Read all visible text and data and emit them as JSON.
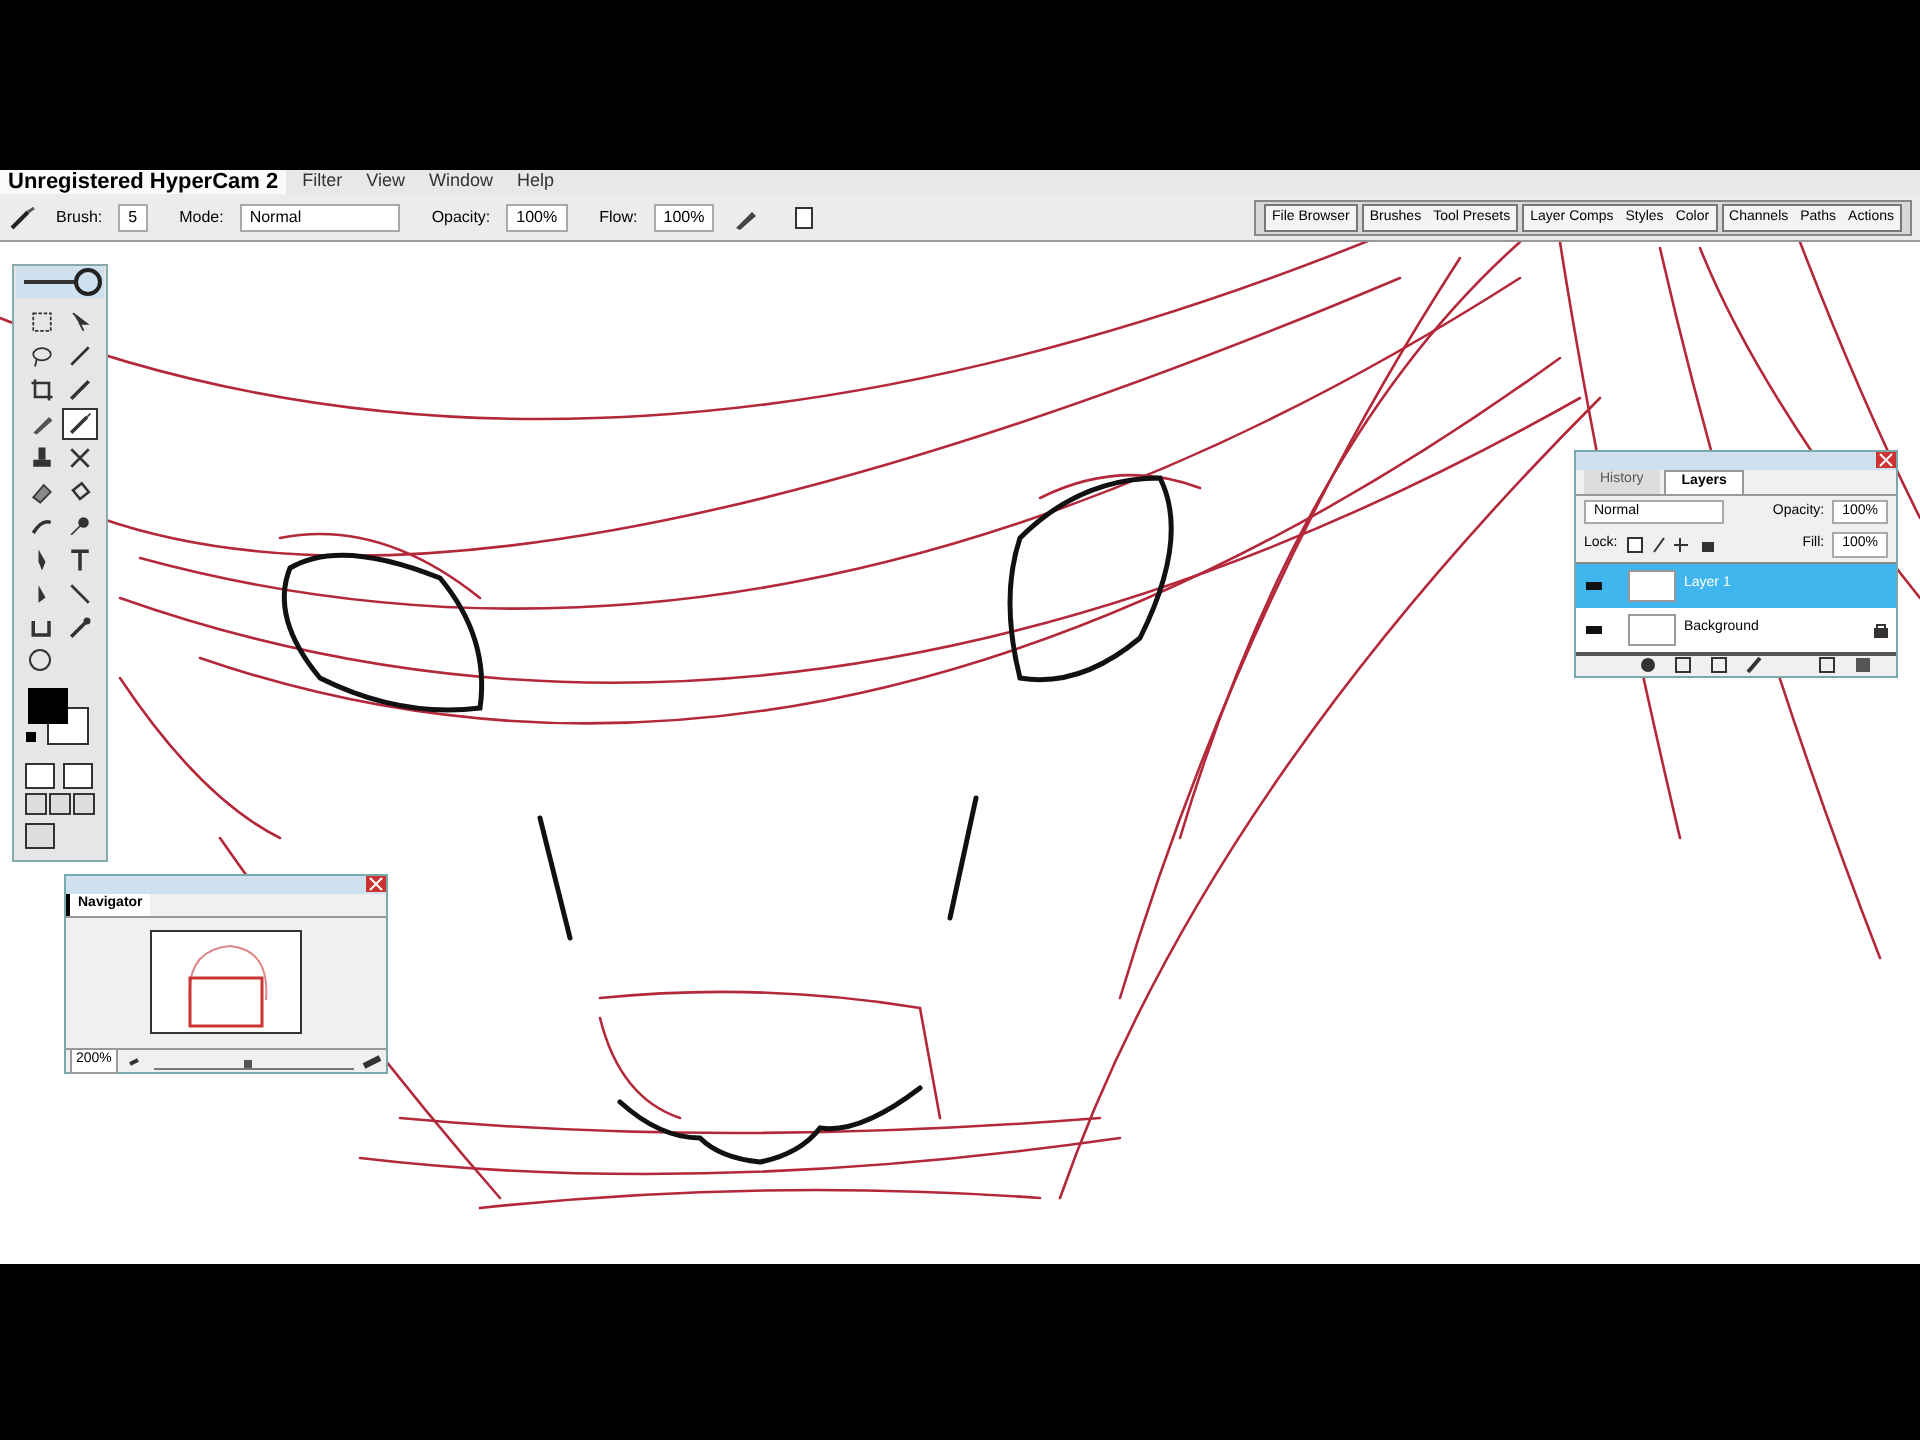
{
  "menu_bar": {
    "items": [
      "Filter",
      "View",
      "Window",
      "Help"
    ]
  },
  "recorder_caption": "Unregistered HyperCam 2",
  "options_bar": {
    "brush_label": "Brush:",
    "brush_size": "5",
    "mode_label": "Mode:",
    "mode": "Normal",
    "opacity_label": "Opacity:",
    "opacity": "100%",
    "flow_label": "Flow:",
    "flow": "100%"
  },
  "palette_well": {
    "groups": [
      [
        "File Browser"
      ],
      [
        "Brushes",
        "Tool Presets"
      ],
      [
        "Layer Comps",
        "Styles",
        "Color"
      ],
      [
        "Channels",
        "Paths",
        "Actions"
      ]
    ]
  },
  "toolbox": {
    "tools": [
      {
        "selected": false
      },
      {
        "selected": false
      },
      {
        "selected": false
      },
      {
        "selected": false
      },
      {
        "selected": false
      },
      {
        "selected": false
      },
      {
        "selected": false
      },
      {
        "selected": true
      },
      {
        "selected": false
      },
      {
        "selected": false
      },
      {
        "selected": false
      },
      {
        "selected": false
      },
      {
        "selected": false
      },
      {
        "selected": false
      },
      {
        "selected": false
      },
      {
        "selected": false
      },
      {
        "selected": false
      },
      {
        "selected": false
      },
      {
        "selected": false
      },
      {
        "selected": false
      }
    ]
  },
  "navigator": {
    "tab": "Navigator",
    "zoom": "200%",
    "zoom_slider": {
      "level": 0.45
    }
  },
  "layers_panel": {
    "tabs": [
      {
        "label": "History",
        "selected": false
      },
      {
        "label": "Layers",
        "selected": true
      }
    ],
    "blend_mode": "Normal",
    "opacity_label": "Opacity:",
    "opacity": "100%",
    "lock_label": "Lock:",
    "fill_label": "Fill:",
    "fill": "100%",
    "layers": [
      {
        "name": "Layer 1",
        "selected": true,
        "locked": false
      },
      {
        "name": "Background",
        "selected": false,
        "locked": true
      }
    ]
  }
}
